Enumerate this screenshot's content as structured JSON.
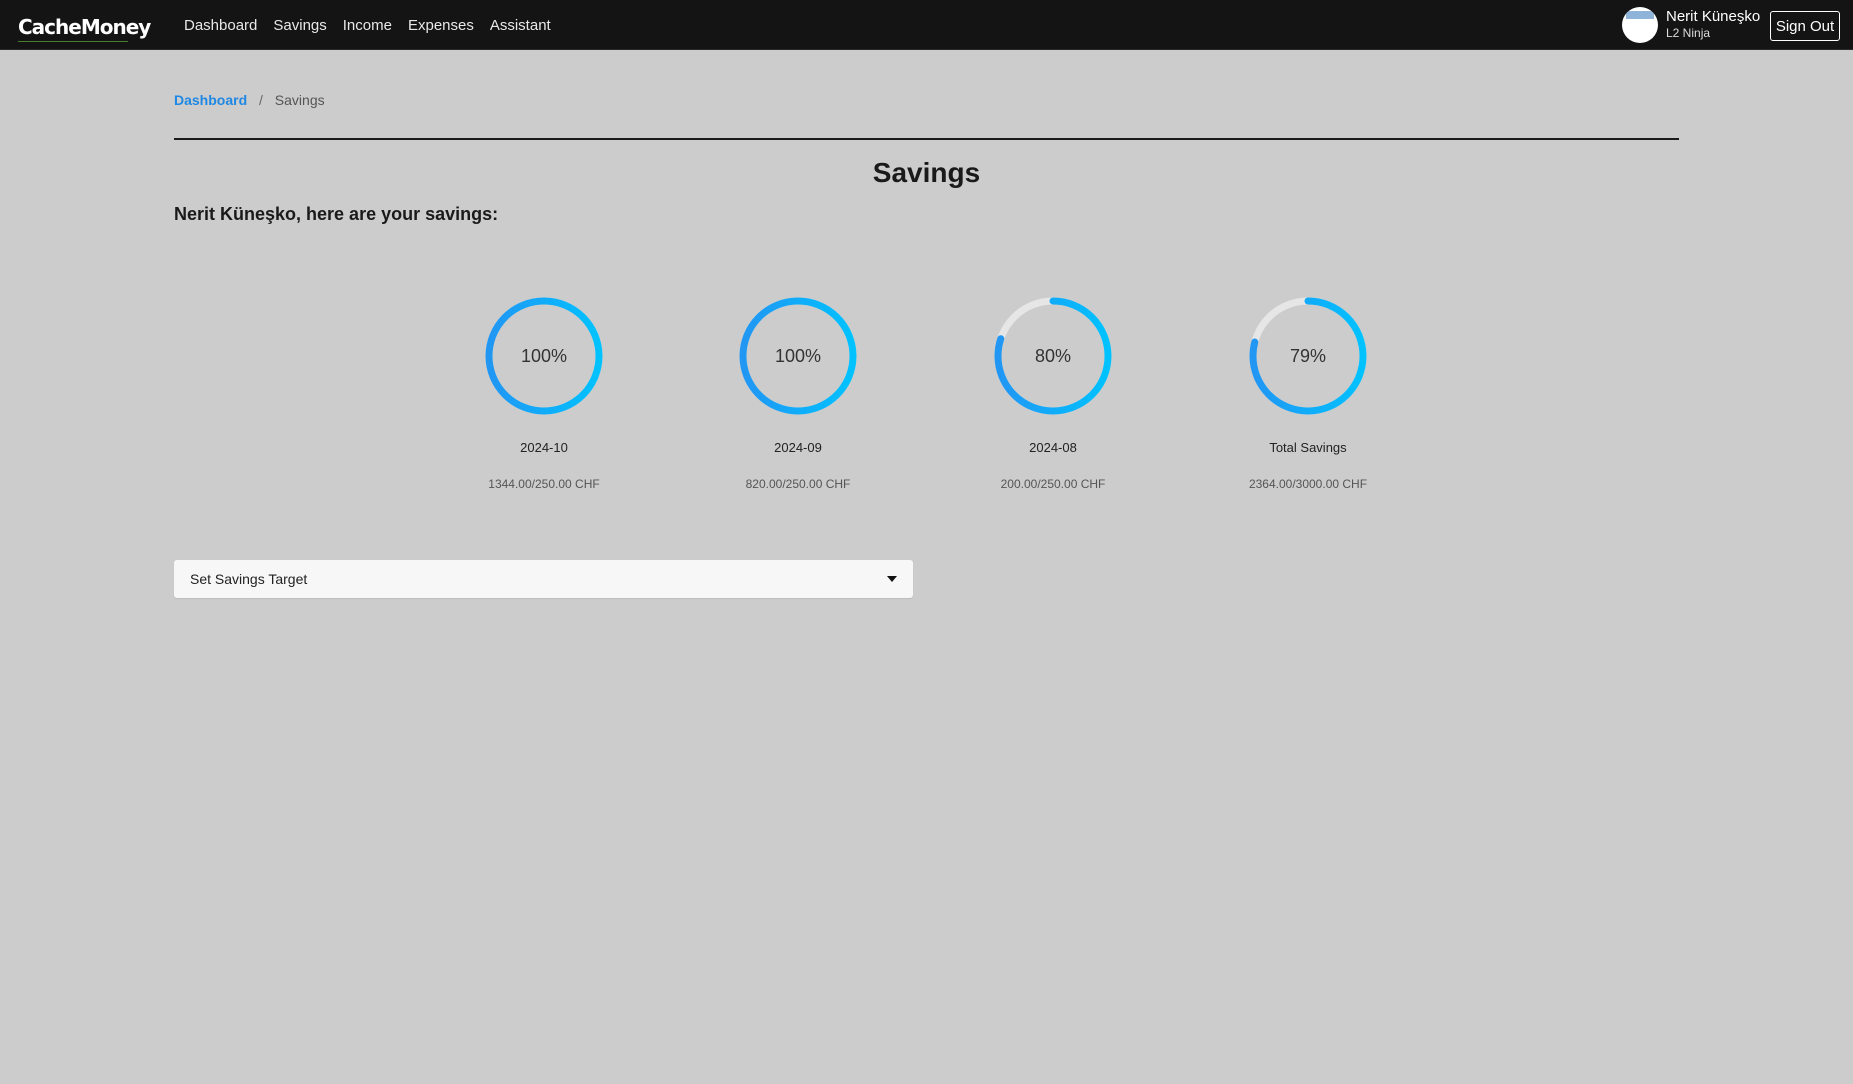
{
  "navbar": {
    "brand": "CacheMoney",
    "links": [
      "Dashboard",
      "Savings",
      "Income",
      "Expenses",
      "Assistant"
    ],
    "user": {
      "name": "Nerit Küneşko",
      "level": "L2 Ninja"
    },
    "signout_label": "Sign Out"
  },
  "breadcrumb": {
    "home": "Dashboard",
    "separator": "/",
    "current": "Savings"
  },
  "page": {
    "title": "Savings",
    "subtitle": "Nerit Küneşko, here are your savings:"
  },
  "gauges": [
    {
      "label": "2024-10",
      "percent": 100,
      "percent_text": "100%",
      "amount": "1344.00/250.00 CHF"
    },
    {
      "label": "2024-09",
      "percent": 100,
      "percent_text": "100%",
      "amount": "820.00/250.00 CHF"
    },
    {
      "label": "2024-08",
      "percent": 80,
      "percent_text": "80%",
      "amount": "200.00/250.00 CHF"
    },
    {
      "label": "Total Savings",
      "percent": 79,
      "percent_text": "79%",
      "amount": "2364.00/3000.00 CHF"
    }
  ],
  "colors": {
    "gauge_start": "#2196f3",
    "gauge_end": "#00c2ff",
    "gauge_track": "#e6e6e6",
    "link": "#1e88e5"
  },
  "savings_target": {
    "label": "Set Savings Target",
    "icon": "caret-down-icon"
  }
}
